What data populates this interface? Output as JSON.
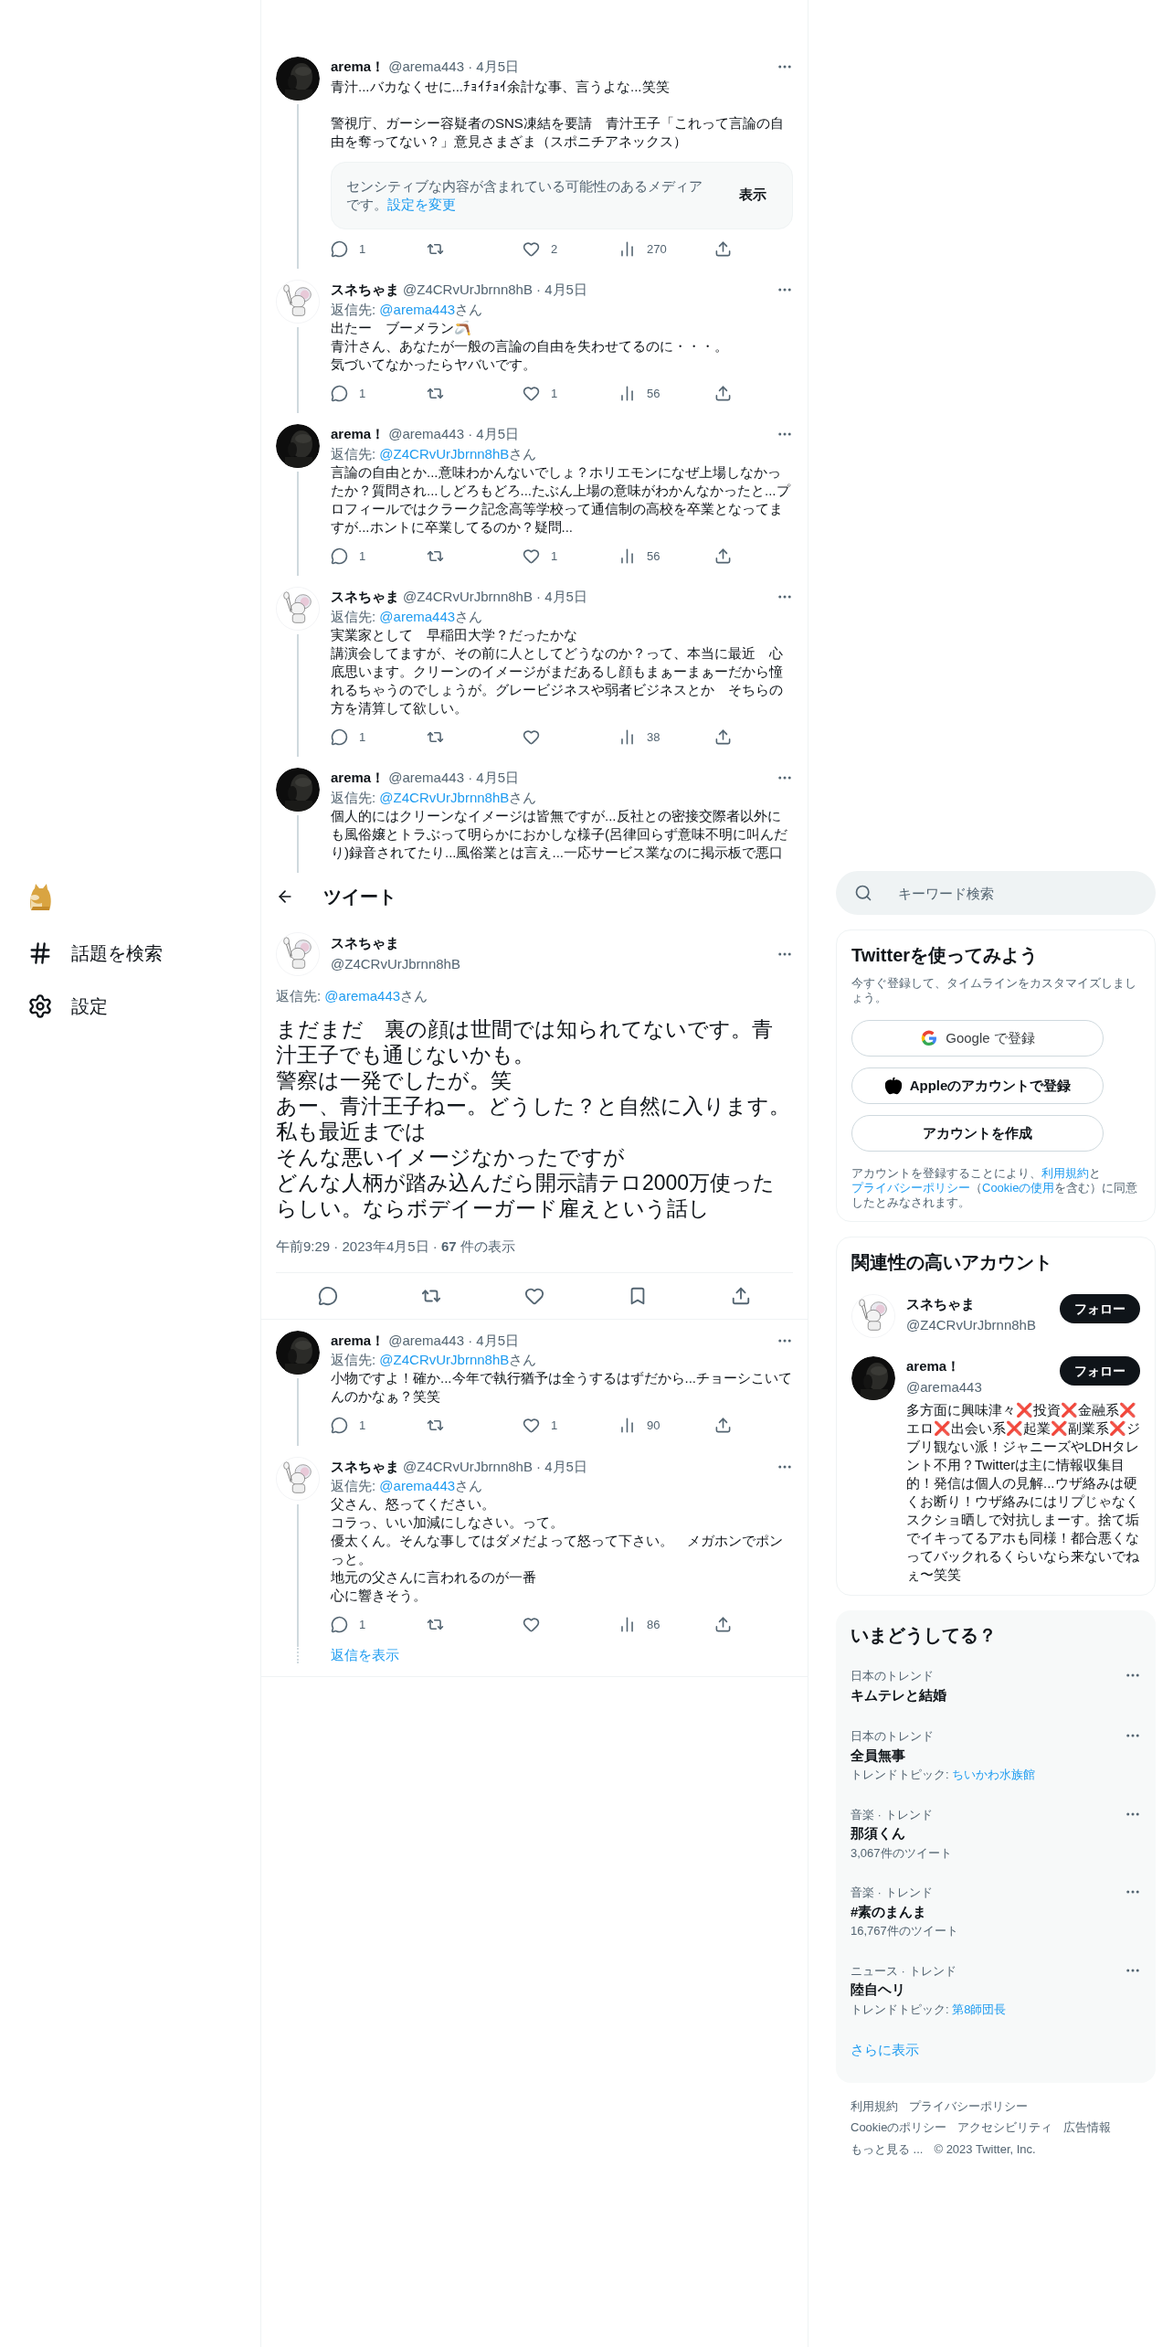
{
  "left_nav": {
    "items": [
      {
        "kind": "hash",
        "label": "話題を検索"
      },
      {
        "kind": "gear",
        "label": "設定"
      }
    ]
  },
  "thread_above": [
    {
      "avatar": {
        "kind": "dark"
      },
      "name": "arema！",
      "meta": "@arema443 · 4月5日",
      "text": [
        [
          "青汁...バカなくせに...ﾁｮｲﾁｮｲ余計な事、言うよな...笑笑"
        ],
        [
          "警視庁、ガーシー容疑者のSNS凍結を要請　青汁王子「これって言論の自由を奪ってない？」意見さまざま（スポニチアネックス）"
        ]
      ],
      "sensitive": {
        "notice": "センシティブな内容が含まれている可能性のあるメディアです。",
        "link": "設定を変更",
        "button": "表示"
      },
      "stats": {
        "replies": "1",
        "likes": "2",
        "views": "270"
      }
    },
    {
      "avatar": {
        "kind": "mouse"
      },
      "name": "スネちゃま",
      "meta": "@Z4CRvUrJbrnn8hB · 4月5日",
      "reply": {
        "label": "返信先: ",
        "to": "@arema443",
        "suffix": "さん"
      },
      "text": [
        [
          "出たー　ブーメラン🪃",
          "青汁さん、あなたが一般の言論の自由を失わせてるのに・・・。",
          "気づいてなかったらヤバいです。"
        ]
      ],
      "stats": {
        "replies": "1",
        "likes": "1",
        "views": "56"
      }
    },
    {
      "avatar": {
        "kind": "dark"
      },
      "name": "arema！",
      "meta": "@arema443 · 4月5日",
      "reply": {
        "label": "返信先: ",
        "to": "@Z4CRvUrJbrnn8hB",
        "suffix": "さん"
      },
      "text": [
        [
          "言論の自由とか...意味わかんないでしょ？ホリエモンになぜ上場しなかったか？質問され...しどろもどろ...たぶん上場の意味がわかんなかったと...プロフィールではクラーク記念高等学校って通信制の高校を卒業となってますが...ホントに卒業してるのか？疑問..."
        ]
      ],
      "stats": {
        "replies": "1",
        "likes": "1",
        "views": "56"
      }
    },
    {
      "avatar": {
        "kind": "mouse"
      },
      "name": "スネちゃま",
      "meta": "@Z4CRvUrJbrnn8hB · 4月5日",
      "reply": {
        "label": "返信先: ",
        "to": "@arema443",
        "suffix": "さん"
      },
      "text": [
        [
          "実業家として　早稲田大学？だったかな",
          "講演会してますが、その前に人としてどうなのか？って、本当に最近　心底思います。クリーンのイメージがまだあるし顔もまぁーまぁーだから憧れるちゃうのでしょうが。グレービジネスや弱者ビジネスとか　そちらの方を清算して欲しい。"
        ]
      ],
      "stats": {
        "replies": "1",
        "views": "38"
      }
    },
    {
      "avatar": {
        "kind": "dark"
      },
      "name": "arema！",
      "meta": "@arema443 · 4月5日",
      "reply": {
        "label": "返信先: ",
        "to": "@Z4CRvUrJbrnn8hB",
        "suffix": "さん"
      },
      "text": [
        [
          "個人的にはクリーンなイメージは皆無ですが...反社との密接交際者以外にも風俗嬢とトラぶって明らかにおかしな様子(呂律回らず意味不明に叫んだり)録音されてたり...風俗業とは言え...一応サービス業なのに掲示板で悪口"
        ]
      ]
    }
  ],
  "header": {
    "title": "ツイート"
  },
  "main_tweet": {
    "avatar": {
      "kind": "mouse"
    },
    "name": "スネちゃま",
    "handle": "@Z4CRvUrJbrnn8hB",
    "reply": {
      "label": "返信先: ",
      "to": "@arema443",
      "suffix": "さん"
    },
    "text": [
      [
        "まだまだ　裏の顔は世間では知られてないです。青汁王子でも通じないかも。",
        "警察は一発でしたが。笑",
        "あー、青汁王子ねー。どうした？と自然に入ります。",
        "私も最近までは",
        "そんな悪いイメージなかったですが",
        "どんな人柄が踏み込んだら開示請テロ2000万使ったらしい。ならボデイーガード雇えという話し"
      ]
    ],
    "meta": "午前9:29 · 2023年4月5日 · **67** 件の表示"
  },
  "replies": [
    {
      "avatar": {
        "kind": "dark"
      },
      "name": "arema！",
      "meta": "@arema443 · 4月5日",
      "reply": {
        "label": "返信先: ",
        "to": "@Z4CRvUrJbrnn8hB",
        "suffix": "さん"
      },
      "text": [
        [
          "小物ですよ！確か...今年で執行猶予は全うするはずだから...チョーシこいてんのかなぁ？笑笑"
        ]
      ],
      "stats": {
        "replies": "1",
        "likes": "1",
        "views": "90"
      }
    },
    {
      "avatar": {
        "kind": "mouse"
      },
      "name": "スネちゃま",
      "meta": "@Z4CRvUrJbrnn8hB · 4月5日",
      "reply": {
        "label": "返信先: ",
        "to": "@arema443",
        "suffix": "さん"
      },
      "text": [
        [
          "父さん、怒ってください。",
          "コラっ、いい加減にしなさい。って。",
          "優太くん。そんな事してはダメだよって怒って下さい。　メガホンでポンっと。",
          "地元の父さんに言われるのが一番",
          "心に響きそう。"
        ]
      ],
      "stats": {
        "replies": "1",
        "views": "86"
      }
    }
  ],
  "show_replies": "返信を表示",
  "sidebar": {
    "search": {
      "placeholder": "キーワード検索"
    },
    "signup": {
      "title": "Twitterを使ってみよう",
      "subtitle": "今すぐ登録して、タイムラインをカスタマイズしましょう。",
      "buttons": [
        {
          "kind": "google",
          "label": "Google で登録"
        },
        {
          "kind": "apple",
          "label": "Appleのアカウントで登録"
        },
        {
          "kind": "plain",
          "label": "アカウントを作成"
        }
      ],
      "legal": {
        "before": "アカウントを登録することにより、",
        "terms": "利用規約",
        "and": "と",
        "privacy": "プライバシーポリシー",
        "open": "（",
        "cookie": "Cookieの使用",
        "after": "を含む）に同意したとみなされます。"
      }
    },
    "related": {
      "title": "関連性の高いアカウント",
      "accounts": [
        {
          "avatar": {
            "kind": "mouse"
          },
          "name": "スネちゃま",
          "handle": "@Z4CRvUrJbrnn8hB",
          "follow": "フォロー"
        },
        {
          "avatar": {
            "kind": "dark"
          },
          "name": "arema！",
          "handle": "@arema443",
          "follow": "フォロー",
          "bio": "多方面に興味津々❌投資❌金融系❌エロ❌出会い系❌起業❌副業系❌ジブリ観ない派！ジャニーズやLDHタレント不用？Twitterは主に情報収集目的！発信は個人の見解...ウザ絡みは硬くお断り！ウザ絡みにはリプじゃなくスクショ晒しで対抗しまーす。捨て垢でイキってるアホも同様！都合悪くなってバックれるくらいなら来ないでねぇ〜笑笑"
        }
      ]
    },
    "trends": {
      "title": "いまどうしてる？",
      "items": [
        {
          "category": "日本のトレンド",
          "title": "キムテレと結婚"
        },
        {
          "category": "日本のトレンド",
          "title": "全員無事",
          "topic": {
            "label": "トレンドトピック: ",
            "link": "ちいかわ水族館"
          }
        },
        {
          "category": "音楽 · トレンド",
          "title": "那須くん",
          "count": "3,067件のツイート"
        },
        {
          "category": "音楽 · トレンド",
          "title": "#素のまんま",
          "count": "16,767件のツイート"
        },
        {
          "category": "ニュース · トレンド",
          "title": "陸自ヘリ",
          "topic": {
            "label": "トレンドトピック: ",
            "link": "第8師団長"
          }
        }
      ],
      "more": "さらに表示"
    },
    "footer": [
      "利用規約",
      "プライバシーポリシー",
      "Cookieのポリシー",
      "アクセシビリティ",
      "広告情報",
      "もっと見る ...",
      "© 2023 Twitter, Inc."
    ]
  }
}
